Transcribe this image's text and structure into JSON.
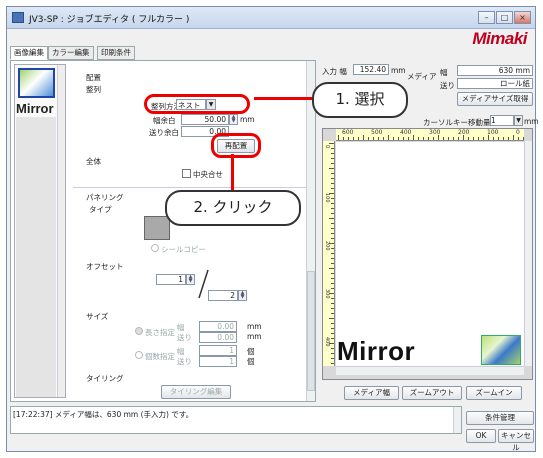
{
  "window": {
    "title": "JV3-SP : ジョブエディタ ( フルカラー )",
    "logo": "Mimaki"
  },
  "tabs": [
    "画像編集",
    "カラー編集",
    "印刷条件"
  ],
  "thumb": {
    "label": "Mirror"
  },
  "layout": {
    "heading": "配置",
    "align": "整列",
    "align_method_label": "整列方法",
    "align_method_value": "ネスト",
    "width_margin_label": "幅余白",
    "width_margin_value": "50.00",
    "unit_mm": "mm",
    "feed_margin_label": "送り余白",
    "feed_margin_value": "0.00",
    "rearrange_button": "再配置"
  },
  "whole": {
    "heading": "全体",
    "center_label": "中央合せ"
  },
  "paneling": {
    "heading": "パネリング",
    "type_label": "タイプ",
    "seal_copy_label": "シールコピー"
  },
  "offset": {
    "heading": "オフセット",
    "x_value": "1",
    "y_value": "2"
  },
  "size": {
    "heading": "サイズ",
    "length_spec": "長さ指定",
    "count_spec": "個数指定",
    "width_label": "幅",
    "feed_label": "送り",
    "len_width": "0.00",
    "len_feed": "0.00",
    "cnt_width": "1",
    "cnt_feed": "1",
    "unit_mm": "mm",
    "unit_count": "個"
  },
  "tiling": {
    "heading": "タイリング",
    "edit_button": "タイリング編集"
  },
  "right": {
    "input_width_label": "入力 幅",
    "input_width_value": "152.40",
    "input_unit": "mm",
    "media_label": "メディア",
    "width_label": "幅",
    "width_value": "630 mm",
    "feed_label": "送り",
    "feed_value": "ロール紙",
    "get_size_button": "メディアサイズ取得",
    "cursor_label": "カーソルキー移動量",
    "cursor_value": "1",
    "cursor_unit": "mm",
    "ruler_ticks": [
      "600",
      "500",
      "400",
      "300",
      "200",
      "100",
      "0"
    ],
    "v_ruler_ticks": [
      "0",
      "100",
      "200",
      "300",
      "400"
    ],
    "preview_label": "Mirror",
    "media_width_button": "メディア幅",
    "zoom_out_button": "ズームアウト",
    "zoom_in_button": "ズームイン"
  },
  "status": {
    "message": "[17:22:37] メディア幅は、630 mm (手入力) です。",
    "manage_button": "条件管理",
    "ok_button": "OK",
    "cancel_button": "キャンセル"
  },
  "callouts": {
    "select": "1. 選択",
    "click": "2. クリック"
  }
}
